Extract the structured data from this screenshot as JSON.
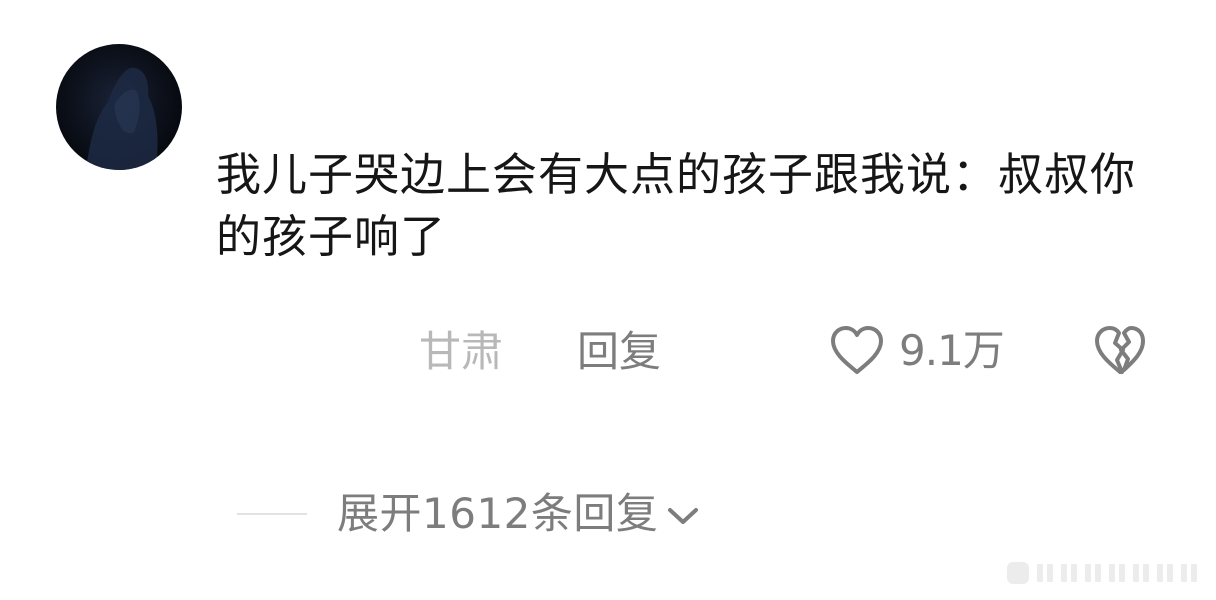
{
  "comment": {
    "avatar_icon": "user-avatar-dark",
    "text": "我儿子哭边上会有大点的孩子跟我说：叔叔你的孩子响了",
    "location": "甘肃",
    "reply_label": "回复",
    "like_icon": "heart-outline-icon",
    "like_count": "9.1万",
    "dislike_icon": "broken-heart-icon"
  },
  "thread": {
    "expand_label": "展开1612条回复",
    "expand_icon": "chevron-down-icon"
  },
  "colors": {
    "text_primary": "#161616",
    "text_secondary": "#7d7d7d",
    "text_muted": "#b8b8b8",
    "divider": "#e2e2e2"
  }
}
